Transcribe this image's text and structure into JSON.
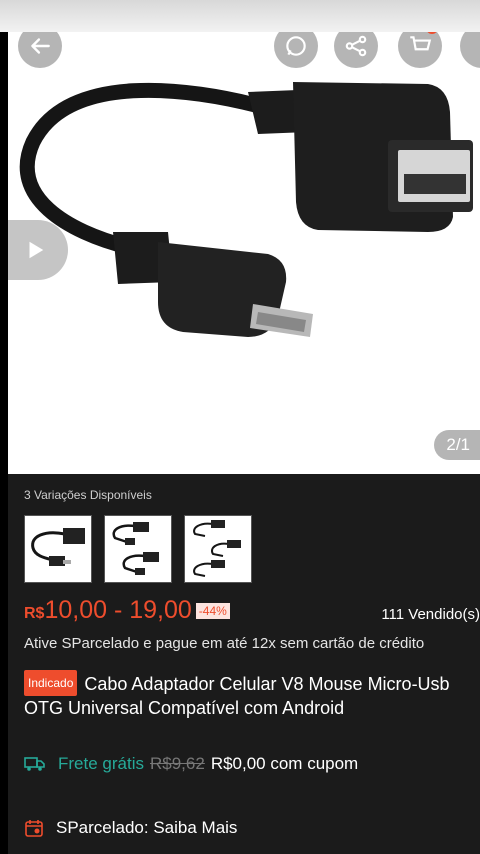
{
  "hero": {
    "image_counter": "2/1"
  },
  "icons": {
    "back": "arrow-left-icon",
    "chat": "whatsapp-icon",
    "share": "share-icon",
    "cart": "cart-icon",
    "play": "play-icon"
  },
  "product": {
    "variations_title": "3 Variações Disponíveis",
    "price_currency": "R$",
    "price_range": "10,00 - 19,00",
    "discount": "-44%",
    "sold": "111 Vendido(s)",
    "installment_text": "Ative SParcelado e pague em até 12x sem cartão de crédito",
    "tag": "Indicado",
    "title_line1": "Cabo Adaptador Celular V8 Mouse Micro-Usb",
    "title_line2": "OTG Universal Compatível com Android"
  },
  "shipping": {
    "free_label": "Frete grátis",
    "old_price": "R$9,62",
    "new_price": "R$0,00 com cupom"
  },
  "sparcelado": {
    "label": "SParcelado: Saiba Mais"
  },
  "colors": {
    "accent": "#ee4d2d",
    "shipping_green": "#26aa99",
    "background_dark": "#1b1b1b"
  }
}
